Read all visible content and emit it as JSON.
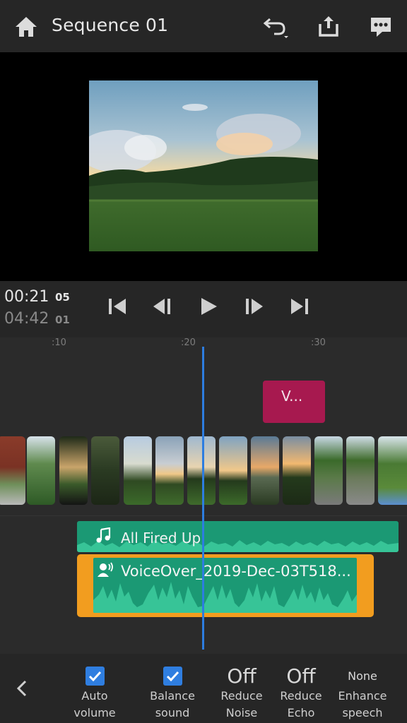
{
  "header": {
    "title": "Sequence 01",
    "icons": [
      "home-icon",
      "undo-icon",
      "share-icon",
      "feedback-icon"
    ]
  },
  "preview": {
    "image_description": "sunset over a tree-covered hill with a grassy field"
  },
  "transport": {
    "current_time": "00:21",
    "current_frame": "05",
    "duration_time": "04:42",
    "duration_frame": "01",
    "controls": [
      "go-to-start",
      "step-back",
      "play",
      "step-forward",
      "go-to-end"
    ]
  },
  "timeline": {
    "ruler_ticks": [
      ":10",
      ":20",
      ":30"
    ],
    "title_clip_label": "V...",
    "audio_track_1": "All Fired Up",
    "audio_track_2": "VoiceOver_2019-Dec-03T518..."
  },
  "bottom_bar": {
    "options": [
      {
        "value": "",
        "checked": true,
        "line1": "Auto",
        "line2": "volume"
      },
      {
        "value": "",
        "checked": true,
        "line1": "Balance",
        "line2": "sound"
      },
      {
        "value": "Off",
        "checked": false,
        "line1": "Reduce",
        "line2": "Noise"
      },
      {
        "value": "Off",
        "checked": false,
        "line1": "Reduce",
        "line2": "Echo"
      },
      {
        "value": "None",
        "checked": false,
        "line1": "Enhance",
        "line2": "speech"
      }
    ]
  },
  "colors": {
    "accent": "#2f7ee0",
    "audio": "#1b9974",
    "selection": "#f29d1f",
    "title_clip": "#a7194f"
  }
}
